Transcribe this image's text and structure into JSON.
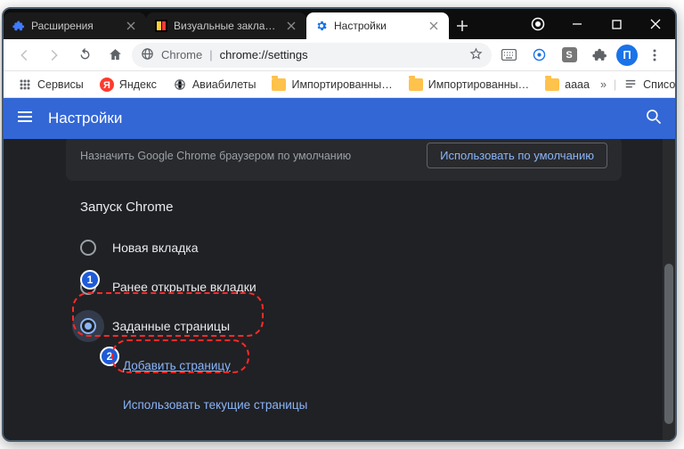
{
  "window": {
    "tabs": [
      {
        "title": "Расширения",
        "icon": "puzzle",
        "active": false
      },
      {
        "title": "Визуальные закладки уд",
        "icon": "yvb",
        "active": false
      },
      {
        "title": "Настройки",
        "icon": "gear",
        "active": true
      }
    ]
  },
  "address": {
    "host": "Chrome",
    "path": "chrome://settings"
  },
  "profile_initial": "П",
  "bookmarks": {
    "items": [
      {
        "label": "Сервисы",
        "type": "apps"
      },
      {
        "label": "Яндекс",
        "type": "yandex"
      },
      {
        "label": "Авиабилеты",
        "type": "globe"
      },
      {
        "label": "Импортированны…",
        "type": "folder"
      },
      {
        "label": "Импортированны…",
        "type": "folder"
      },
      {
        "label": "aaaa",
        "type": "folder"
      }
    ],
    "reading_list": "Список для чтения"
  },
  "settings": {
    "title": "Настройки",
    "default_browser_sub": "Назначить Google Chrome браузером по умолчанию",
    "default_browser_btn": "Использовать по умолчанию",
    "startup_section": "Запуск Chrome",
    "radios": {
      "new_tab": "Новая вкладка",
      "continue": "Ранее открытые вкладки",
      "specific": "Заданные страницы"
    },
    "links": {
      "add_page": "Добавить страницу",
      "use_current": "Использовать текущие страницы"
    }
  },
  "annotations": {
    "badge1": "1",
    "badge2": "2"
  }
}
